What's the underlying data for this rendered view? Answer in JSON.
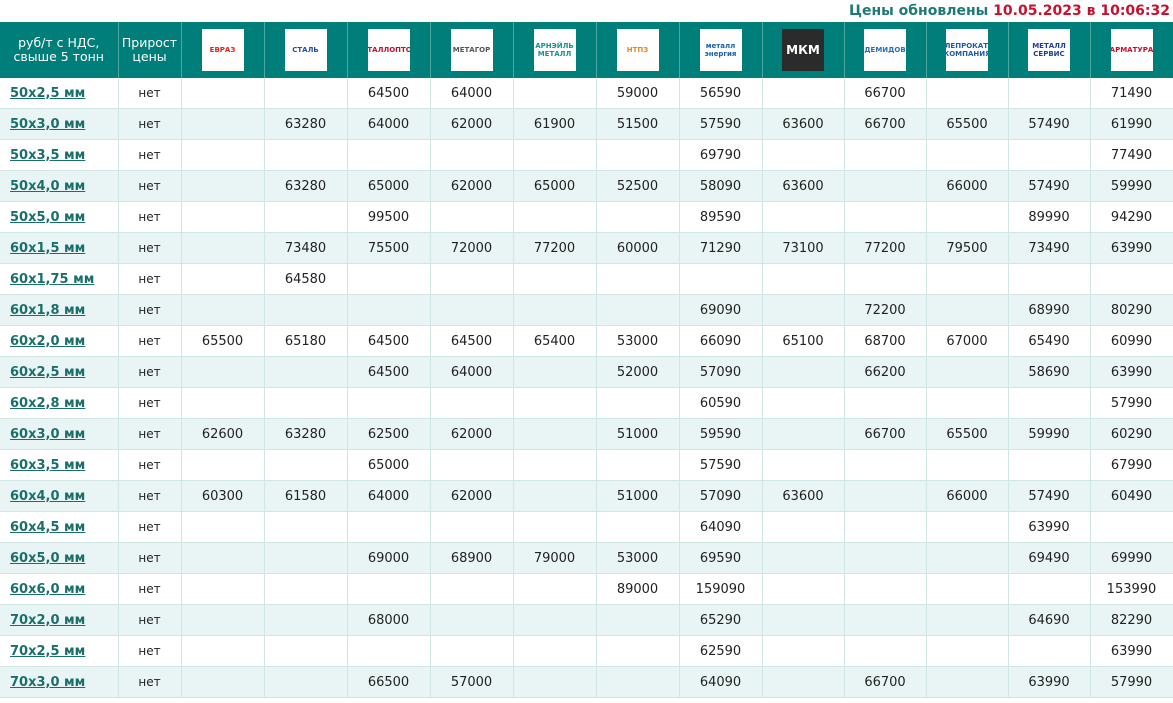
{
  "updated": {
    "prefix": "Цены обновлены",
    "datetime": "10.05.2023 в 10:06:32"
  },
  "header": {
    "col1": "руб/т с НДС, свыше 5 тонн",
    "col2": "Прирост цены",
    "suppliers": [
      {
        "id": "evraz",
        "label": "ЕВРАЗ",
        "color": "#e2231a"
      },
      {
        "id": "stal",
        "label": "СТАЛЬ",
        "color": "#1f4fa3"
      },
      {
        "id": "metalloptorg",
        "label": "МЕТАЛЛОПТОРГ",
        "color": "#c8102e"
      },
      {
        "id": "metagor",
        "label": "МЕТАГОР",
        "color": "#555555"
      },
      {
        "id": "arneil",
        "label": "АРНЭЙЛЬ МЕТАЛЛ",
        "color": "#16928c"
      },
      {
        "id": "ntpz",
        "label": "НТПЗ",
        "color": "#e58a1f"
      },
      {
        "id": "metall-energiya",
        "label": "металл энергия",
        "color": "#1b5fa8"
      },
      {
        "id": "mkm",
        "label": "МКМ",
        "color": "#ffffff"
      },
      {
        "id": "demidov",
        "label": "ДЕМИДОВ",
        "color": "#2d6db5"
      },
      {
        "id": "company",
        "label": "СТАЛЕПРОКАТНАЯ КОМПАНИЯ",
        "color": "#1f5ca8"
      },
      {
        "id": "metallservis",
        "label": "МЕТАЛЛ СЕРВИС",
        "color": "#1f3f8f"
      },
      {
        "id": "armatura",
        "label": "АРМАТУРА",
        "color": "#c8102e"
      }
    ]
  },
  "rows": [
    {
      "size": "50х2,5 мм",
      "growth": "нет",
      "prices": [
        "",
        "",
        "64500",
        "64000",
        "",
        "59000",
        "56590",
        "",
        "66700",
        "",
        "",
        "71490"
      ]
    },
    {
      "size": "50х3,0 мм",
      "growth": "нет",
      "prices": [
        "",
        "63280",
        "64000",
        "62000",
        "61900",
        "51500",
        "57590",
        "63600",
        "66700",
        "65500",
        "57490",
        "61990"
      ]
    },
    {
      "size": "50х3,5 мм",
      "growth": "нет",
      "prices": [
        "",
        "",
        "",
        "",
        "",
        "",
        "69790",
        "",
        "",
        "",
        "",
        "77490"
      ]
    },
    {
      "size": "50х4,0 мм",
      "growth": "нет",
      "prices": [
        "",
        "63280",
        "65000",
        "62000",
        "65000",
        "52500",
        "58090",
        "63600",
        "",
        "66000",
        "57490",
        "59990"
      ]
    },
    {
      "size": "50х5,0 мм",
      "growth": "нет",
      "prices": [
        "",
        "",
        "99500",
        "",
        "",
        "",
        "89590",
        "",
        "",
        "",
        "89990",
        "94290"
      ]
    },
    {
      "size": "60х1,5 мм",
      "growth": "нет",
      "prices": [
        "",
        "73480",
        "75500",
        "72000",
        "77200",
        "60000",
        "71290",
        "73100",
        "77200",
        "79500",
        "73490",
        "63990"
      ]
    },
    {
      "size": "60х1,75 мм",
      "growth": "нет",
      "prices": [
        "",
        "64580",
        "",
        "",
        "",
        "",
        "",
        "",
        "",
        "",
        "",
        ""
      ]
    },
    {
      "size": "60х1,8 мм",
      "growth": "нет",
      "prices": [
        "",
        "",
        "",
        "",
        "",
        "",
        "69090",
        "",
        "72200",
        "",
        "68990",
        "80290"
      ]
    },
    {
      "size": "60х2,0 мм",
      "growth": "нет",
      "prices": [
        "65500",
        "65180",
        "64500",
        "64500",
        "65400",
        "53000",
        "66090",
        "65100",
        "68700",
        "67000",
        "65490",
        "60990"
      ]
    },
    {
      "size": "60х2,5 мм",
      "growth": "нет",
      "prices": [
        "",
        "",
        "64500",
        "64000",
        "",
        "52000",
        "57090",
        "",
        "66200",
        "",
        "58690",
        "63990"
      ]
    },
    {
      "size": "60х2,8 мм",
      "growth": "нет",
      "prices": [
        "",
        "",
        "",
        "",
        "",
        "",
        "60590",
        "",
        "",
        "",
        "",
        "57990"
      ]
    },
    {
      "size": "60х3,0 мм",
      "growth": "нет",
      "prices": [
        "62600",
        "63280",
        "62500",
        "62000",
        "",
        "51000",
        "59590",
        "",
        "66700",
        "65500",
        "59990",
        "60290"
      ]
    },
    {
      "size": "60х3,5 мм",
      "growth": "нет",
      "prices": [
        "",
        "",
        "65000",
        "",
        "",
        "",
        "57590",
        "",
        "",
        "",
        "",
        "67990"
      ]
    },
    {
      "size": "60х4,0 мм",
      "growth": "нет",
      "prices": [
        "60300",
        "61580",
        "64000",
        "62000",
        "",
        "51000",
        "57090",
        "63600",
        "",
        "66000",
        "57490",
        "60490"
      ]
    },
    {
      "size": "60х4,5 мм",
      "growth": "нет",
      "prices": [
        "",
        "",
        "",
        "",
        "",
        "",
        "64090",
        "",
        "",
        "",
        "63990",
        ""
      ]
    },
    {
      "size": "60х5,0 мм",
      "growth": "нет",
      "prices": [
        "",
        "",
        "69000",
        "68900",
        "79000",
        "53000",
        "69590",
        "",
        "",
        "",
        "69490",
        "69990"
      ]
    },
    {
      "size": "60х6,0 мм",
      "growth": "нет",
      "prices": [
        "",
        "",
        "",
        "",
        "",
        "89000",
        "159090",
        "",
        "",
        "",
        "",
        "153990"
      ]
    },
    {
      "size": "70х2,0 мм",
      "growth": "нет",
      "prices": [
        "",
        "",
        "68000",
        "",
        "",
        "",
        "65290",
        "",
        "",
        "",
        "64690",
        "82290"
      ]
    },
    {
      "size": "70х2,5 мм",
      "growth": "нет",
      "prices": [
        "",
        "",
        "",
        "",
        "",
        "",
        "62590",
        "",
        "",
        "",
        "",
        "63990"
      ]
    },
    {
      "size": "70х3,0 мм",
      "growth": "нет",
      "prices": [
        "",
        "",
        "66500",
        "57000",
        "",
        "",
        "64090",
        "",
        "66700",
        "",
        "63990",
        "57990"
      ]
    }
  ]
}
